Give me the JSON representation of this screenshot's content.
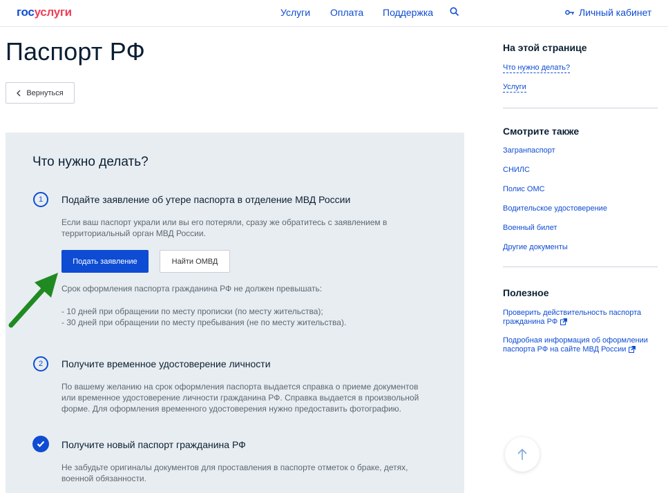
{
  "header": {
    "logo_part1": "гос",
    "logo_part2": "услуги",
    "nav": [
      "Услуги",
      "Оплата",
      "Поддержка"
    ],
    "cabinet_label": "Личный кабинет"
  },
  "page": {
    "title": "Паспорт РФ",
    "back_label": "Вернуться"
  },
  "main": {
    "section_title": "Что нужно делать?",
    "steps": [
      {
        "number": "1",
        "title": "Подайте заявление об утере паспорта в отделение МВД России",
        "text": "Если ваш паспорт украли или вы его потеряли, сразу же обратитесь с заявлением в территориальный орган МВД России.",
        "primary_button": "Подать заявление",
        "secondary_button": "Найти ОМВД",
        "deadline_intro": "Срок оформления паспорта гражданина РФ не должен превышать:",
        "deadline_line1": "- 10 дней при обращении по месту прописки (по месту жительства);",
        "deadline_line2": "- 30 дней при обращении по месту пребывания (не по месту жительства)."
      },
      {
        "number": "2",
        "title": "Получите временное удостоверение личности",
        "text": "По вашему желанию на срок оформления паспорта выдается справка о приеме документов или временное удостоверение личности гражданина РФ. Справка выдается в произвольной форме. Для оформления временного удостоверения нужно предоставить фотографию."
      },
      {
        "icon": "check-icon",
        "title": "Получите новый паспорт гражданина РФ",
        "text": "Не забудьте оригиналы документов для проставления в паспорте отметок о браке, детях, военной обязанности."
      }
    ]
  },
  "sidebar": {
    "on_page_title": "На этой странице",
    "on_page_links": [
      "Что нужно делать?",
      "Услуги"
    ],
    "see_also_title": "Смотрите также",
    "see_also_links": [
      "Загранпаспорт",
      "СНИЛС",
      "Полис ОМС",
      "Водительское удостоверение",
      "Военный билет",
      "Другие документы"
    ],
    "useful_title": "Полезное",
    "useful_links": [
      {
        "line1": "Проверить действительность паспорта",
        "line2": "гражданина РФ"
      },
      {
        "line1": "Подробная информация об оформлении",
        "line2": "паспорта РФ на сайте МВД России"
      }
    ]
  },
  "colors": {
    "brand_blue": "#0d4cd3",
    "brand_red": "#ee3f58",
    "panel_bg": "#e8edf1",
    "annotation_arrow": "#1f8a21"
  }
}
